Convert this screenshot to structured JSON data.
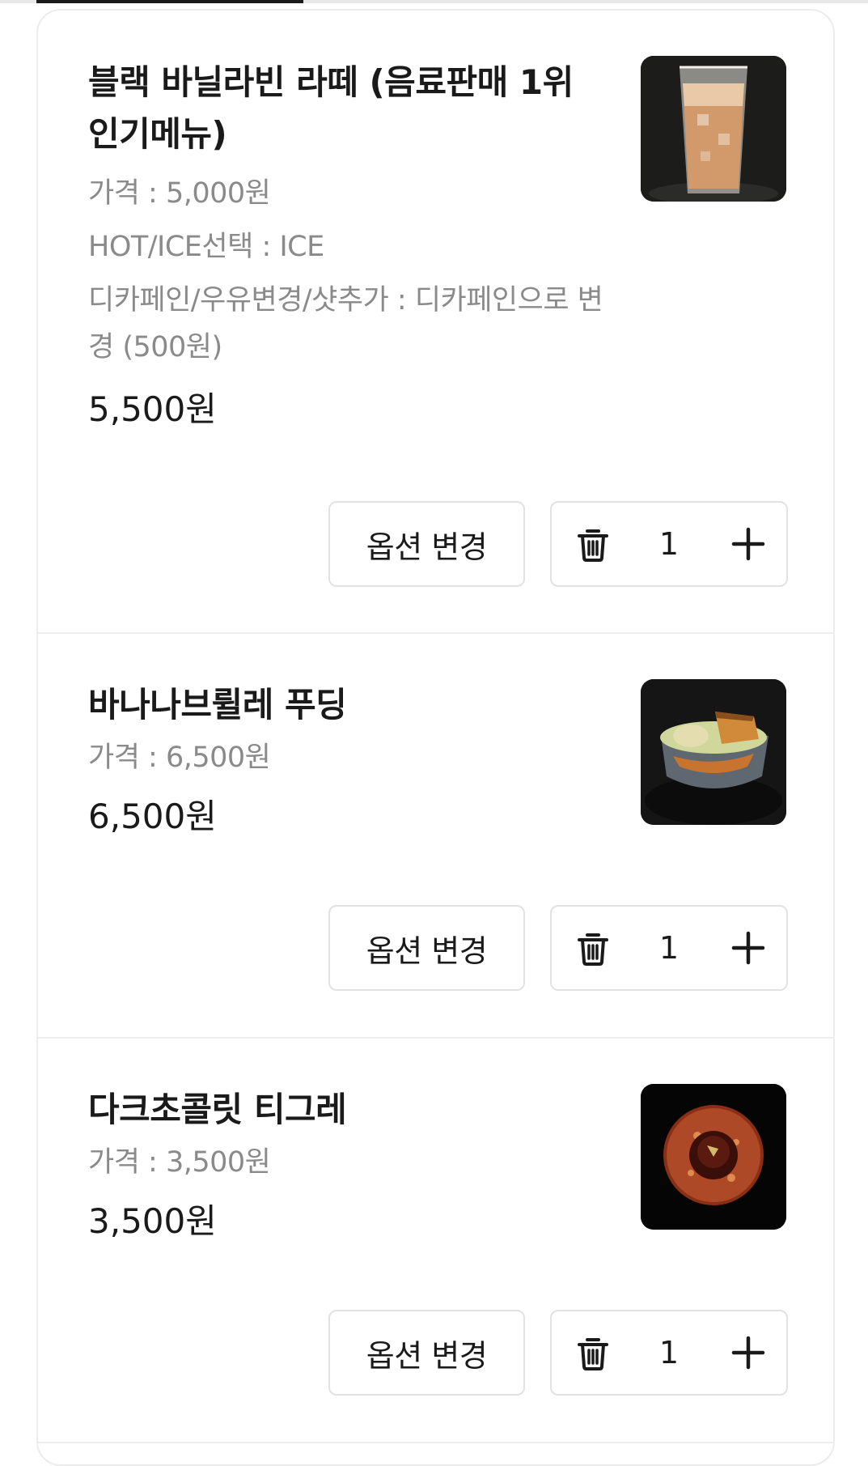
{
  "cart": {
    "option_button_label": "옵션 변경",
    "items": [
      {
        "name": "블랙 바닐라빈 라떼 (음료판매 1위 인기메뉴)",
        "options": [
          "가격 : 5,000원",
          "HOT/ICE선택 : ICE",
          "디카페인/우유변경/샷추가 : 디카페인으로 변경 (500원)"
        ],
        "total": "5,500원",
        "quantity": "1",
        "image": "iced-latte-photo"
      },
      {
        "name": "바나나브륄레 푸딩",
        "options": [
          "가격 : 6,500원"
        ],
        "total": "6,500원",
        "quantity": "1",
        "image": "pudding-bowl-photo"
      },
      {
        "name": "다크초콜릿 티그레",
        "options": [
          "가격 : 3,500원"
        ],
        "total": "3,500원",
        "quantity": "1",
        "image": "chocolate-tigre-photo"
      }
    ]
  },
  "icons": {
    "delete": "trash-icon",
    "increase": "plus-icon"
  },
  "colors": {
    "text_primary": "#1a1a1a",
    "text_secondary": "#8a8a8a",
    "border": "#e2e2e2"
  }
}
